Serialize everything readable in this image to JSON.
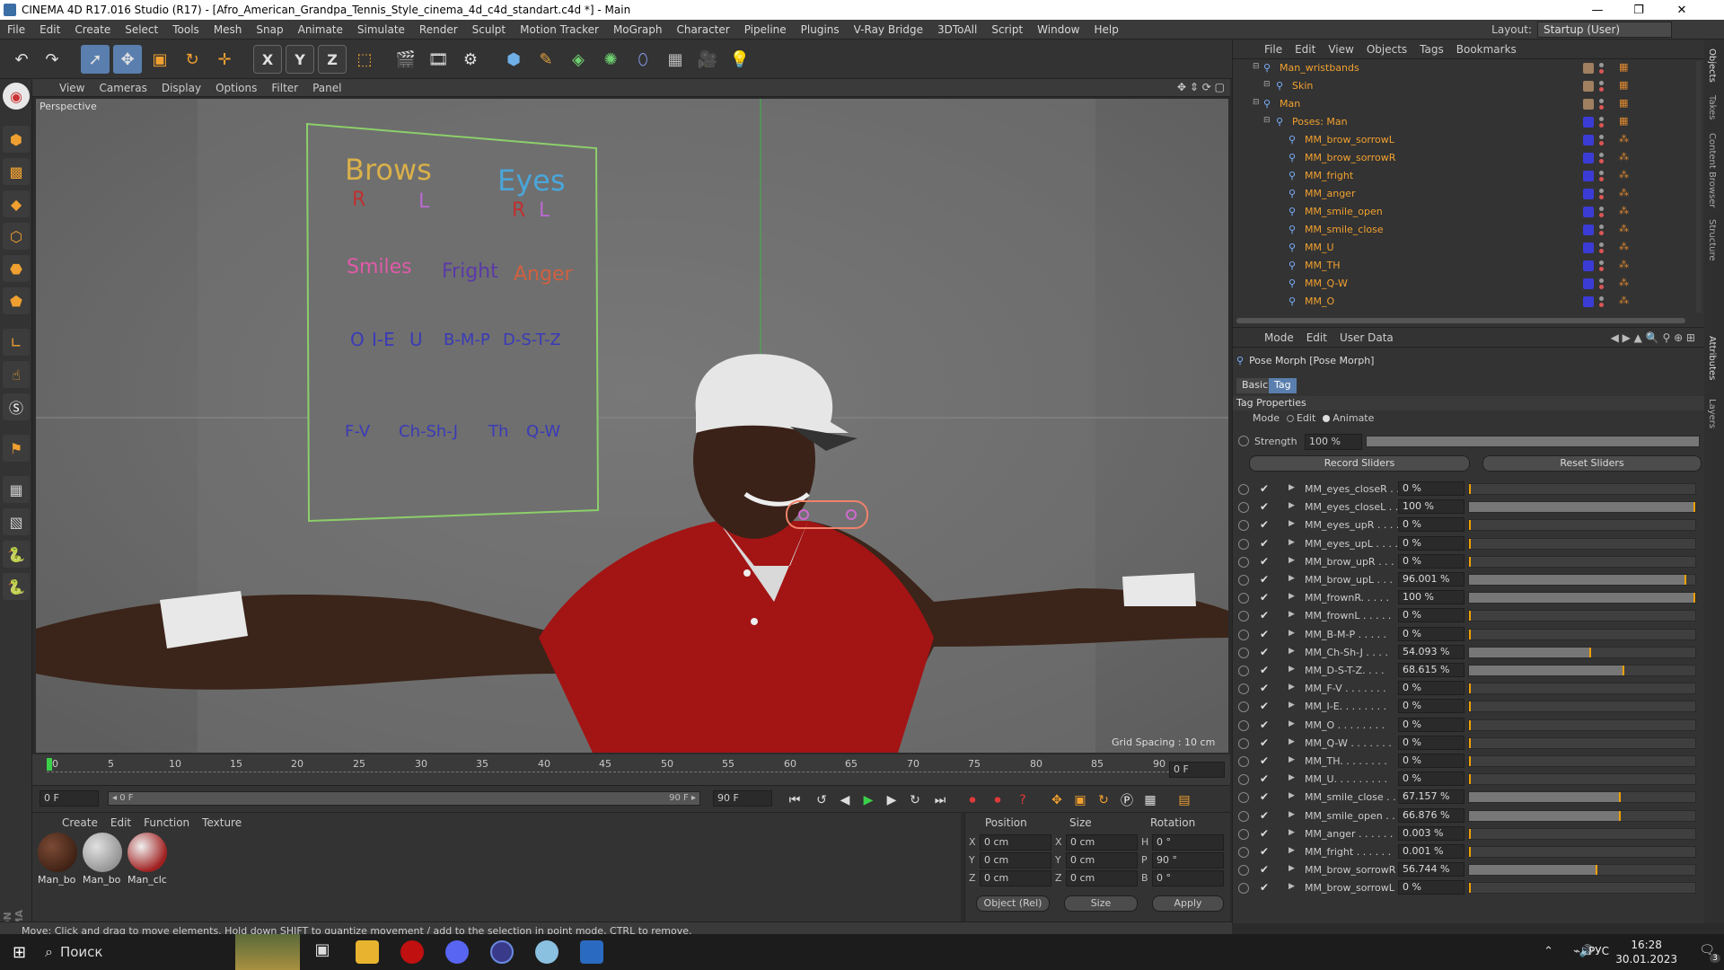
{
  "window": {
    "title": "CINEMA 4D R17.016 Studio (R17) - [Afro_American_Grandpa_Tennis_Style_cinema_4d_c4d_standart.c4d *] - Main",
    "minimize": "—",
    "maximize": "❐",
    "close": "✕"
  },
  "menubar": [
    "File",
    "Edit",
    "Create",
    "Select",
    "Tools",
    "Mesh",
    "Snap",
    "Animate",
    "Simulate",
    "Render",
    "Sculpt",
    "Motion Tracker",
    "MoGraph",
    "Character",
    "Pipeline",
    "Plugins",
    "V-Ray Bridge",
    "3DToAll",
    "Script",
    "Window",
    "Help"
  ],
  "layout": {
    "label": "Layout:",
    "value": "Startup (User)"
  },
  "toolbar": {
    "x_axis": "X",
    "y_axis": "Y",
    "z_axis": "Z"
  },
  "viewport": {
    "menu": [
      "View",
      "Cameras",
      "Display",
      "Options",
      "Filter",
      "Panel"
    ],
    "label": "Perspective",
    "grid_spacing": "Grid Spacing : 10 cm",
    "face_rig": {
      "brows": "Brows",
      "eyes": "Eyes",
      "brows_r": "R",
      "brows_l": "L",
      "eyes_r": "R",
      "eyes_l": "L",
      "smiles": "Smiles",
      "fright": "Fright",
      "anger": "Anger",
      "o": "O",
      "ie": "I-E",
      "u": "U",
      "bmp": "B-M-P",
      "dstz": "D-S-T-Z",
      "fv": "F-V",
      "chshj": "Ch-Sh-J",
      "th": "Th",
      "qw": "Q-W"
    }
  },
  "timeline": {
    "ticks": [
      "0",
      "5",
      "10",
      "15",
      "20",
      "25",
      "30",
      "35",
      "40",
      "45",
      "50",
      "55",
      "60",
      "65",
      "70",
      "75",
      "80",
      "85",
      "90"
    ],
    "current_frame": "0 F",
    "start_field": "0 F",
    "range_start": "◂ 0 F",
    "range_end": "90 F ▸",
    "end_field": "90 F"
  },
  "material_manager": {
    "menu": [
      "Create",
      "Edit",
      "Function",
      "Texture"
    ],
    "materials": [
      "Man_bo",
      "Man_bo",
      "Man_clc"
    ]
  },
  "coordinates": {
    "headers": {
      "position": "Position",
      "size": "Size",
      "rotation": "Rotation"
    },
    "rows": [
      {
        "axis": "X",
        "pos": "0 cm",
        "saxis": "X",
        "size": "0 cm",
        "raxis": "H",
        "rot": "0 °"
      },
      {
        "axis": "Y",
        "pos": "0 cm",
        "saxis": "Y",
        "size": "0 cm",
        "raxis": "P",
        "rot": "90 °"
      },
      {
        "axis": "Z",
        "pos": "0 cm",
        "saxis": "Z",
        "size": "0 cm",
        "raxis": "B",
        "rot": "0 °"
      }
    ],
    "mode": "Object (Rel)",
    "size_mode": "Size",
    "apply": "Apply"
  },
  "status": "Move: Click and drag to move elements. Hold down SHIFT to quantize movement / add to the selection in point mode, CTRL to remove.",
  "object_manager": {
    "menu": [
      "File",
      "Edit",
      "View",
      "Objects",
      "Tags",
      "Bookmarks"
    ],
    "rows": [
      {
        "name": "Man_wristbands",
        "indent": 0,
        "chip": "#a08060"
      },
      {
        "name": "Skin",
        "indent": 1,
        "chip": "#a08060"
      },
      {
        "name": "Man",
        "indent": 0,
        "chip": "#a08060"
      },
      {
        "name": "Poses: Man",
        "indent": 1,
        "chip": "#3b3bd6"
      },
      {
        "name": "MM_brow_sorrowL",
        "indent": 2,
        "chip": "#3b3bd6"
      },
      {
        "name": "MM_brow_sorrowR",
        "indent": 2,
        "chip": "#3b3bd6"
      },
      {
        "name": "MM_fright",
        "indent": 2,
        "chip": "#3b3bd6"
      },
      {
        "name": "MM_anger",
        "indent": 2,
        "chip": "#3b3bd6"
      },
      {
        "name": "MM_smile_open",
        "indent": 2,
        "chip": "#3b3bd6"
      },
      {
        "name": "MM_smile_close",
        "indent": 2,
        "chip": "#3b3bd6"
      },
      {
        "name": "MM_U",
        "indent": 2,
        "chip": "#3b3bd6"
      },
      {
        "name": "MM_TH",
        "indent": 2,
        "chip": "#3b3bd6"
      },
      {
        "name": "MM_Q-W",
        "indent": 2,
        "chip": "#3b3bd6"
      },
      {
        "name": "MM_O",
        "indent": 2,
        "chip": "#3b3bd6"
      }
    ]
  },
  "attribute_manager": {
    "menu": [
      "Mode",
      "Edit",
      "User Data"
    ],
    "object_title": "Pose Morph [Pose Morph]",
    "tabs": [
      "Basic",
      "Tag"
    ],
    "section": "Tag Properties",
    "mode_label": "Mode",
    "mode_edit": "Edit",
    "mode_animate": "Animate",
    "strength_label": "Strength",
    "strength_value": "100 %",
    "record_sliders": "Record Sliders",
    "reset_sliders": "Reset Sliders",
    "sliders": [
      {
        "name": "MM_eyes_closeR . .",
        "value": "0 %",
        "pct": 0
      },
      {
        "name": "MM_eyes_closeL . .",
        "value": "100 %",
        "pct": 100
      },
      {
        "name": "MM_eyes_upR . . . .",
        "value": "0 %",
        "pct": 0
      },
      {
        "name": "MM_eyes_upL . . . .",
        "value": "0 %",
        "pct": 0
      },
      {
        "name": "MM_brow_upR . . .",
        "value": "0 %",
        "pct": 0
      },
      {
        "name": "MM_brow_upL . . .",
        "value": "96.001 %",
        "pct": 96.001
      },
      {
        "name": "MM_frownR. . . . .",
        "value": "100 %",
        "pct": 100
      },
      {
        "name": "MM_frownL . . . . .",
        "value": "0 %",
        "pct": 0
      },
      {
        "name": "MM_B-M-P . . . . .",
        "value": "0 %",
        "pct": 0
      },
      {
        "name": "MM_Ch-Sh-J . . . .",
        "value": "54.093 %",
        "pct": 54.093
      },
      {
        "name": "MM_D-S-T-Z. . . .",
        "value": "68.615 %",
        "pct": 68.615
      },
      {
        "name": "MM_F-V . . . . . . .",
        "value": "0 %",
        "pct": 0
      },
      {
        "name": "MM_I-E. . . . . . . .",
        "value": "0 %",
        "pct": 0
      },
      {
        "name": "MM_O . . . . . . . .",
        "value": "0 %",
        "pct": 0
      },
      {
        "name": "MM_Q-W . . . . . . .",
        "value": "0 %",
        "pct": 0
      },
      {
        "name": "MM_TH. . . . . . . .",
        "value": "0 %",
        "pct": 0
      },
      {
        "name": "MM_U. . . . . . . . .",
        "value": "0 %",
        "pct": 0
      },
      {
        "name": "MM_smile_close . .",
        "value": "67.157 %",
        "pct": 67.157
      },
      {
        "name": "MM_smile_open . .",
        "value": "66.876 %",
        "pct": 66.876
      },
      {
        "name": "MM_anger . . . . . .",
        "value": "0.003 %",
        "pct": 0.003
      },
      {
        "name": "MM_fright . . . . . .",
        "value": "0.001 %",
        "pct": 0.001
      },
      {
        "name": "MM_brow_sorrowR",
        "value": "56.744 %",
        "pct": 56.744
      },
      {
        "name": "MM_brow_sorrowL",
        "value": "0 %",
        "pct": 0
      }
    ]
  },
  "side_tabs": [
    "Objects",
    "Takes",
    "Content Browser",
    "Structure",
    "Attributes",
    "Layers"
  ],
  "taskbar": {
    "search": "Поиск",
    "lang": "РУС",
    "time": "16:28",
    "date": "30.01.2023",
    "notifications": "3"
  }
}
